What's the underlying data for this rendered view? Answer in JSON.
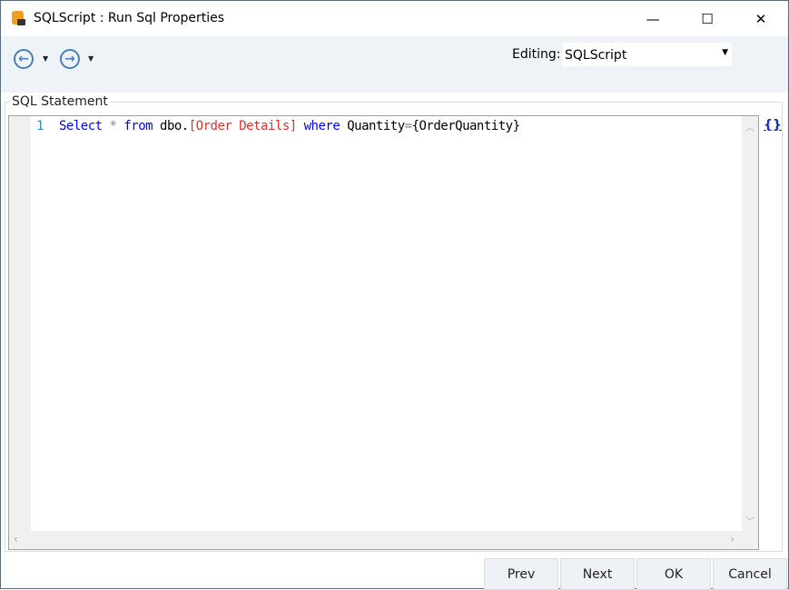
{
  "window": {
    "title": "SQLScript : Run Sql Properties",
    "minimize": "—",
    "maximize": "☐",
    "close": "✕"
  },
  "toolbar": {
    "back_icon": "←",
    "forward_icon": "→",
    "dropdown_icon": "▼",
    "editing_label": "Editing:",
    "editing_value": "SQLScript"
  },
  "group": {
    "label": "SQL Statement"
  },
  "editor": {
    "line_number": "1",
    "tokens": {
      "select": "Select",
      "star": " * ",
      "from": "from",
      "dbo": " dbo.",
      "table": "[Order Details]",
      "sp": " ",
      "where": "where",
      "rest": " Quantity",
      "eq": "=",
      "param": "{OrderQuantity}"
    }
  },
  "side": {
    "braces": "{}"
  },
  "buttons": {
    "prev": "Prev",
    "next": "Next",
    "ok": "OK",
    "cancel": "Cancel"
  }
}
